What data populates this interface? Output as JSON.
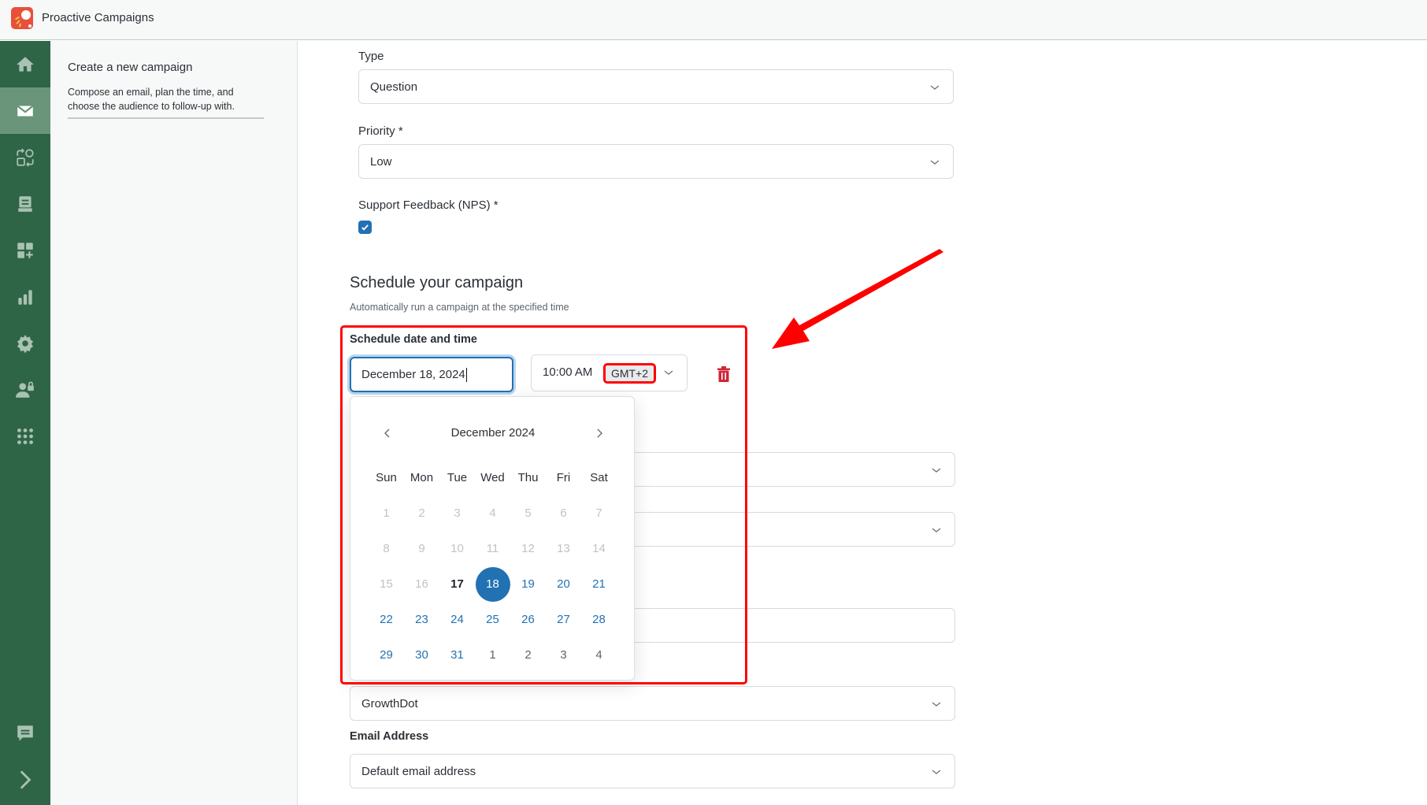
{
  "app": {
    "title": "Proactive Campaigns",
    "logo_icon": "proactive-campaigns-logo"
  },
  "sidebar": {
    "items": [
      {
        "name": "home",
        "icon": "home-icon",
        "active": false
      },
      {
        "name": "campaigns",
        "icon": "mail-icon",
        "active": true
      },
      {
        "name": "workflows",
        "icon": "shapes-cycle-icon",
        "active": false
      },
      {
        "name": "inbox",
        "icon": "inbox-tray-icon",
        "active": false
      },
      {
        "name": "apps",
        "icon": "add-widget-icon",
        "active": false
      },
      {
        "name": "reports",
        "icon": "bar-chart-icon",
        "active": false
      },
      {
        "name": "settings",
        "icon": "gear-icon",
        "active": false
      },
      {
        "name": "permissions",
        "icon": "user-lock-icon",
        "active": false
      },
      {
        "name": "more-apps",
        "icon": "grid-dots-icon",
        "active": false
      }
    ],
    "bottom_items": [
      {
        "name": "feedback",
        "icon": "chat-icon"
      },
      {
        "name": "expand",
        "icon": "chevron-right-icon"
      }
    ]
  },
  "subpanel": {
    "title": "Create a new campaign",
    "description": "Compose an email, plan the time, and choose the audience to follow-up with."
  },
  "form": {
    "type": {
      "label": "Type",
      "value": "Question"
    },
    "priority": {
      "label": "Priority *",
      "value": "Low"
    },
    "support_feedback": {
      "label": "Support Feedback (NPS) *",
      "checked": true
    },
    "schedule": {
      "title": "Schedule your campaign",
      "subtitle": "Automatically run a campaign at the specified time",
      "field_label": "Schedule date and time",
      "date_value": "December 18, 2024",
      "time_value": "10:00 AM",
      "timezone": "GMT+2"
    },
    "brand": {
      "value": "GrowthDot"
    },
    "email_address": {
      "label": "Email Address",
      "value": "Default email address"
    }
  },
  "calendar": {
    "month_label": "December 2024",
    "weekdays": [
      "Sun",
      "Mon",
      "Tue",
      "Wed",
      "Thu",
      "Fri",
      "Sat"
    ],
    "weeks": [
      [
        {
          "d": "1",
          "s": "disabled"
        },
        {
          "d": "2",
          "s": "disabled"
        },
        {
          "d": "3",
          "s": "disabled"
        },
        {
          "d": "4",
          "s": "disabled"
        },
        {
          "d": "5",
          "s": "disabled"
        },
        {
          "d": "6",
          "s": "disabled"
        },
        {
          "d": "7",
          "s": "disabled"
        }
      ],
      [
        {
          "d": "8",
          "s": "disabled"
        },
        {
          "d": "9",
          "s": "disabled"
        },
        {
          "d": "10",
          "s": "disabled"
        },
        {
          "d": "11",
          "s": "disabled"
        },
        {
          "d": "12",
          "s": "disabled"
        },
        {
          "d": "13",
          "s": "disabled"
        },
        {
          "d": "14",
          "s": "disabled"
        }
      ],
      [
        {
          "d": "15",
          "s": "disabled"
        },
        {
          "d": "16",
          "s": "disabled"
        },
        {
          "d": "17",
          "s": "today"
        },
        {
          "d": "18",
          "s": "selected"
        },
        {
          "d": "19",
          "s": "available"
        },
        {
          "d": "20",
          "s": "available"
        },
        {
          "d": "21",
          "s": "available"
        }
      ],
      [
        {
          "d": "22",
          "s": "available"
        },
        {
          "d": "23",
          "s": "available"
        },
        {
          "d": "24",
          "s": "available"
        },
        {
          "d": "25",
          "s": "available"
        },
        {
          "d": "26",
          "s": "available"
        },
        {
          "d": "27",
          "s": "available"
        },
        {
          "d": "28",
          "s": "available"
        }
      ],
      [
        {
          "d": "29",
          "s": "available"
        },
        {
          "d": "30",
          "s": "available"
        },
        {
          "d": "31",
          "s": "available"
        },
        {
          "d": "1",
          "s": "other"
        },
        {
          "d": "2",
          "s": "other"
        },
        {
          "d": "3",
          "s": "other"
        },
        {
          "d": "4",
          "s": "other"
        }
      ]
    ]
  },
  "annotations": {
    "highlight_color": "#ff0000",
    "arrow_color": "#ff0000"
  },
  "colors": {
    "sidebar_bg": "#2e6547",
    "sidebar_active": "#6a957a",
    "accent": "#2271b3",
    "danger": "#d0263a"
  }
}
